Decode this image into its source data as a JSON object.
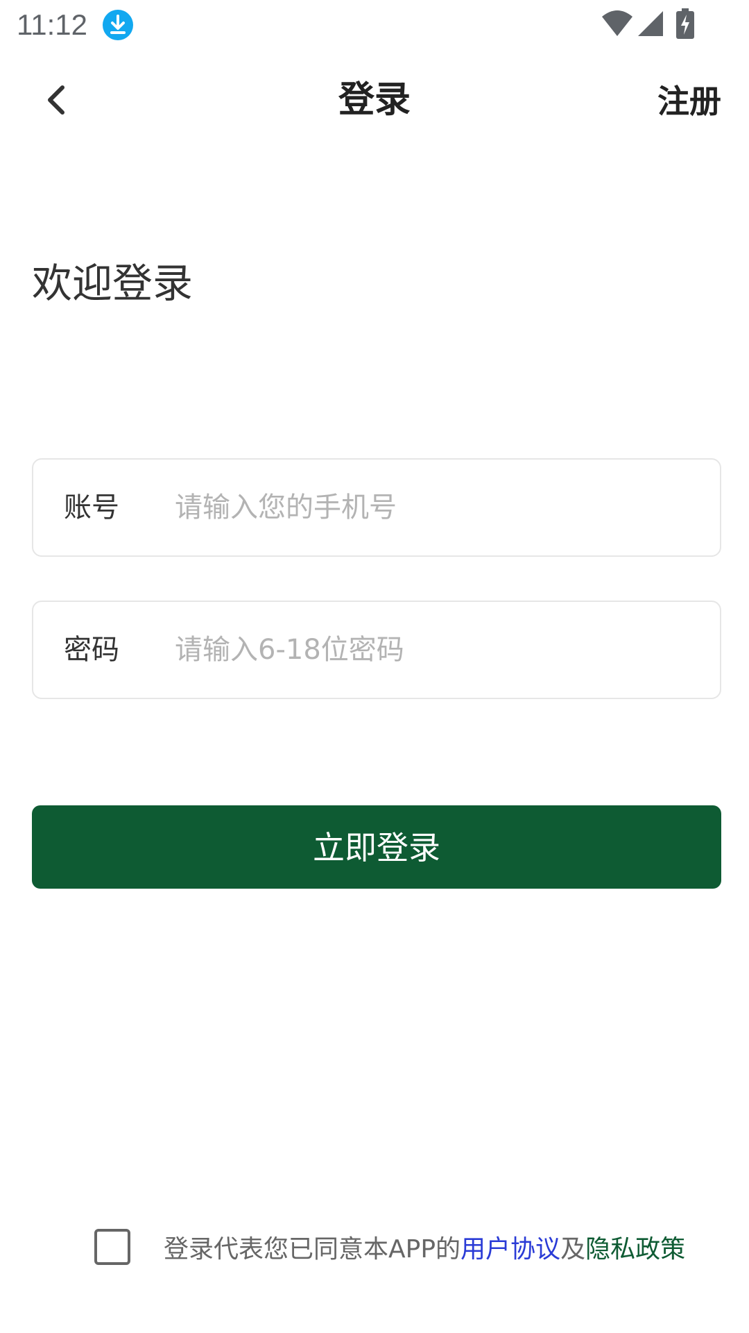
{
  "status_bar": {
    "time": "11:12",
    "icons": [
      "download-icon",
      "wifi-icon",
      "signal-icon",
      "battery-icon"
    ],
    "download_icon_color": "#12a8f0"
  },
  "header": {
    "back_icon": "chevron-left-icon",
    "title": "登录",
    "register_label": "注册"
  },
  "welcome": {
    "text": "欢迎登录"
  },
  "form": {
    "account": {
      "label": "账号",
      "placeholder": "请输入您的手机号",
      "value": ""
    },
    "password": {
      "label": "密码",
      "placeholder": "请输入6-18位密码",
      "value": ""
    },
    "submit_label": "立即登录"
  },
  "agreement": {
    "checked": false,
    "prefix": "登录代表您已同意本APP的",
    "user_agreement": "用户协议",
    "conjunction": "及",
    "privacy_policy": "隐私政策"
  },
  "colors": {
    "primary": "#0e5b33",
    "link_user_agreement": "#2a3bd6",
    "link_privacy_policy": "#0e5b33",
    "field_border": "#e6e6e6",
    "placeholder": "#b3b3b3"
  }
}
